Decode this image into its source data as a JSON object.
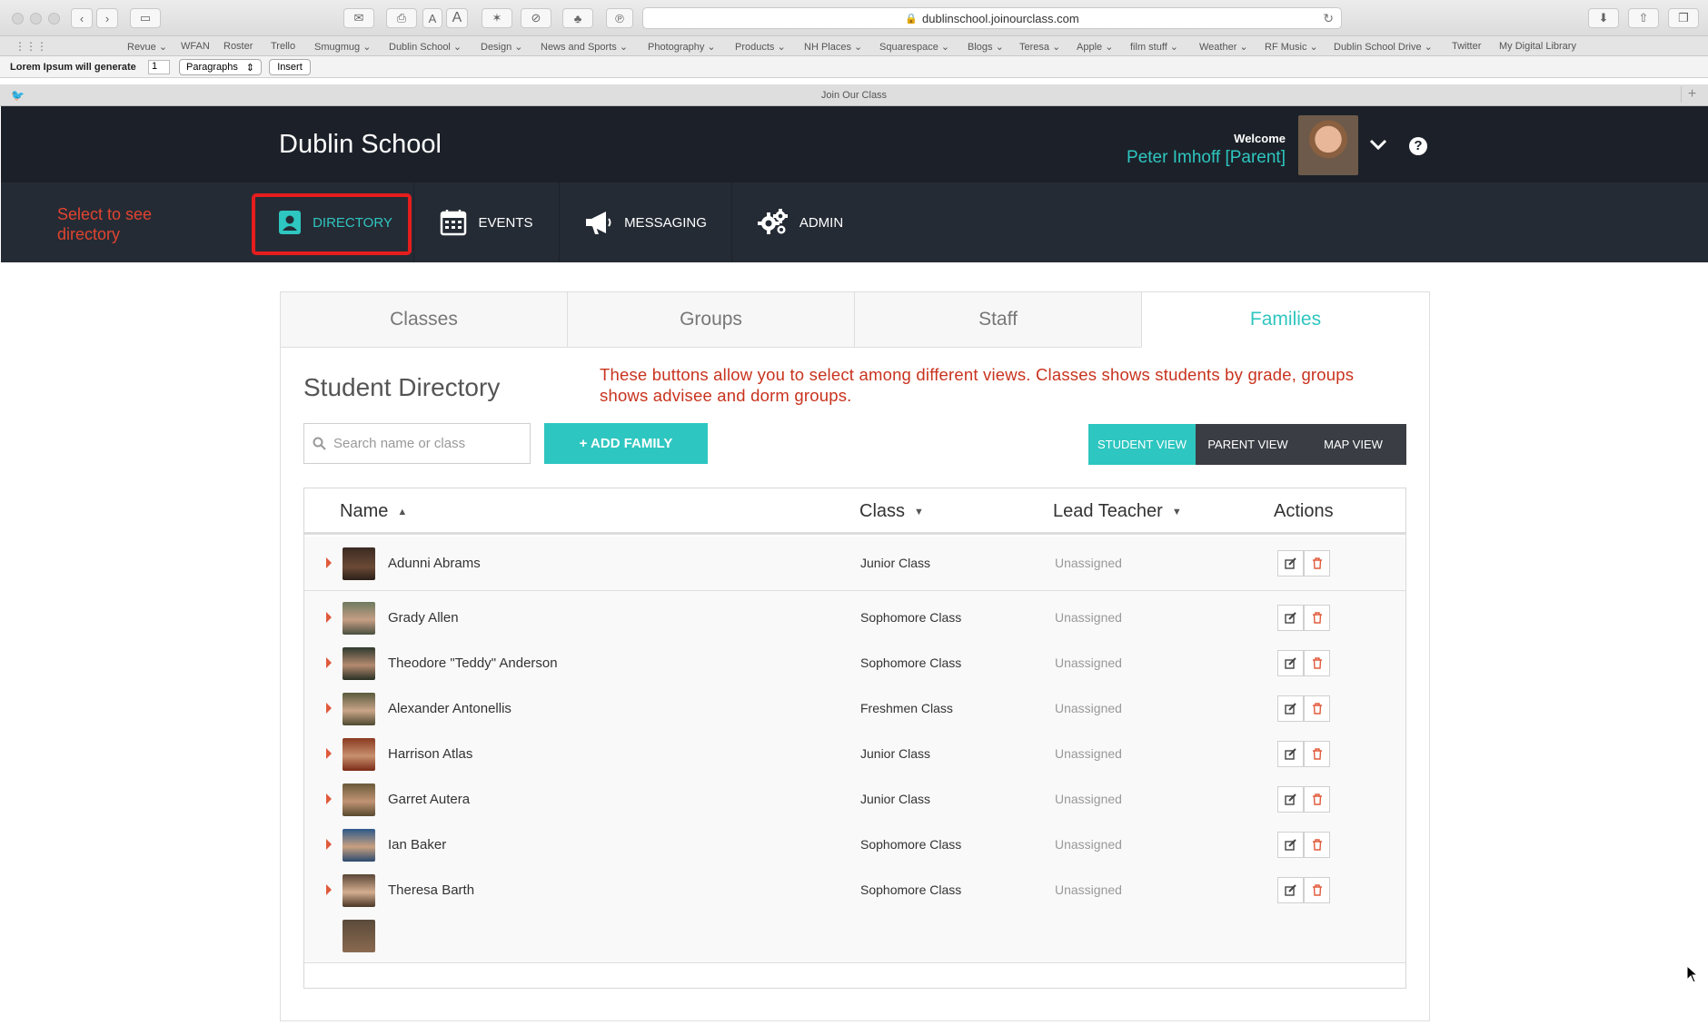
{
  "browser": {
    "url": "dublinschool.joinourclass.com",
    "tab_title": "Join Our Class",
    "bookmarks": [
      "Revue ⌄",
      "WFAN",
      "Roster",
      "Trello",
      "Smugmug ⌄",
      "Dublin School ⌄",
      "Design ⌄",
      "News and Sports ⌄",
      "Photography ⌄",
      "Products ⌄",
      "NH Places ⌄",
      "Squarespace ⌄",
      "Blogs ⌄",
      "Teresa ⌄",
      "Apple ⌄",
      "film stuff ⌄",
      "Weather ⌄",
      "RF Music ⌄",
      "Dublin School Drive ⌄",
      "Twitter",
      "My Digital Library"
    ],
    "lipsum": {
      "label": "Lorem Ipsum will generate",
      "count": "1",
      "unit": "Paragraphs",
      "insert": "Insert"
    }
  },
  "header": {
    "school_name": "Dublin School",
    "welcome": "Welcome",
    "user_name": "Peter Imhoff [Parent]"
  },
  "nav": {
    "callout": "Select to see directory",
    "items": [
      {
        "label": "DIRECTORY",
        "icon": "directory-icon"
      },
      {
        "label": "EVENTS",
        "icon": "calendar-icon"
      },
      {
        "label": "MESSAGING",
        "icon": "megaphone-icon"
      },
      {
        "label": "ADMIN",
        "icon": "gears-icon"
      }
    ]
  },
  "tabs": [
    "Classes",
    "Groups",
    "Staff",
    "Families"
  ],
  "active_tab": "Families",
  "directory": {
    "title": "Student Directory",
    "note": "These buttons allow you to select among different views. Classes shows students by grade, groups shows advisee and dorm groups.",
    "search_placeholder": "Search name or class",
    "add_button": "+ ADD FAMILY",
    "views": [
      "STUDENT VIEW",
      "PARENT VIEW",
      "MAP VIEW"
    ],
    "active_view": "STUDENT VIEW"
  },
  "table": {
    "columns": [
      "Name",
      "Class",
      "Lead Teacher",
      "Actions"
    ],
    "rows": [
      {
        "name": "Adunni Abrams",
        "class": "Junior Class",
        "lead_teacher": "Unassigned"
      },
      {
        "name": "Grady Allen",
        "class": "Sophomore Class",
        "lead_teacher": "Unassigned"
      },
      {
        "name": "Theodore \"Teddy\" Anderson",
        "class": "Sophomore Class",
        "lead_teacher": "Unassigned"
      },
      {
        "name": "Alexander Antonellis",
        "class": "Freshmen Class",
        "lead_teacher": "Unassigned"
      },
      {
        "name": "Harrison Atlas",
        "class": "Junior Class",
        "lead_teacher": "Unassigned"
      },
      {
        "name": "Garret Autera",
        "class": "Junior Class",
        "lead_teacher": "Unassigned"
      },
      {
        "name": "Ian Baker",
        "class": "Sophomore Class",
        "lead_teacher": "Unassigned"
      },
      {
        "name": "Theresa Barth",
        "class": "Sophomore Class",
        "lead_teacher": "Unassigned"
      }
    ]
  },
  "colors": {
    "accent": "#2ec6c0",
    "header_bg": "#1c2129",
    "nav_bg": "#252b35",
    "callout_red": "#e0442f",
    "highlight_box": "#e61d1d"
  }
}
